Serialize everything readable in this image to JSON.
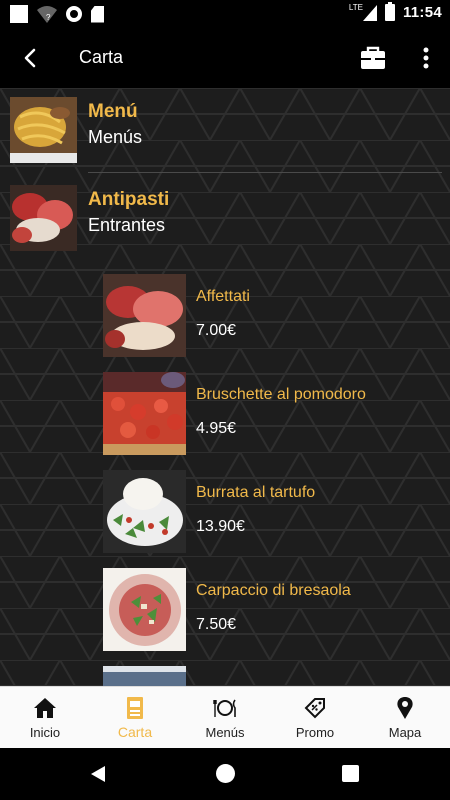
{
  "status_bar": {
    "network": "LTE",
    "time": "11:54"
  },
  "app_bar": {
    "title": "Carta"
  },
  "categories": [
    {
      "name": "Menú",
      "subtitle": "Menús"
    },
    {
      "name": "Antipasti",
      "subtitle": "Entrantes"
    }
  ],
  "items": [
    {
      "name": "Affettati",
      "price": "7.00€"
    },
    {
      "name": "Bruschette al pomodoro",
      "price": "4.95€"
    },
    {
      "name": "Burrata al tartufo",
      "price": "13.90€"
    },
    {
      "name": "Carpaccio di bresaola",
      "price": "7.50€"
    }
  ],
  "bottom_nav": [
    {
      "label": "Inicio",
      "icon": "home-icon",
      "active": false
    },
    {
      "label": "Carta",
      "icon": "menu-card-icon",
      "active": true
    },
    {
      "label": "Menús",
      "icon": "plate-cutlery-icon",
      "active": false
    },
    {
      "label": "Promo",
      "icon": "discount-tag-icon",
      "active": false
    },
    {
      "label": "Mapa",
      "icon": "map-pin-icon",
      "active": false
    }
  ],
  "colors": {
    "accent": "#f1b94a",
    "background": "#1d1d1d",
    "appbar": "#000000",
    "nav_bg": "#fafafa"
  }
}
